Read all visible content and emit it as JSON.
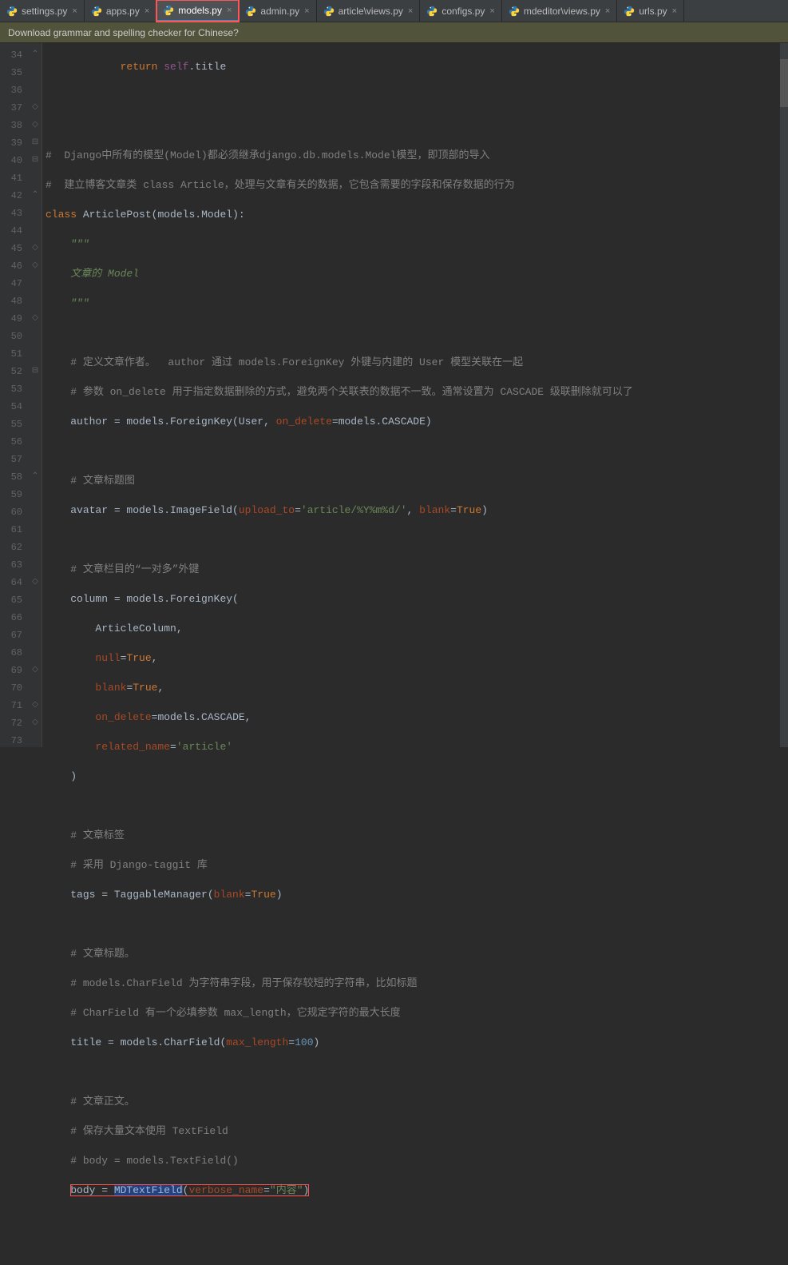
{
  "tabs": [
    {
      "label": "settings.py"
    },
    {
      "label": "apps.py"
    },
    {
      "label": "models.py",
      "active": true,
      "highlighted": true
    },
    {
      "label": "admin.py"
    },
    {
      "label": "article\\views.py"
    },
    {
      "label": "configs.py"
    },
    {
      "label": "mdeditor\\views.py"
    },
    {
      "label": "urls.py"
    }
  ],
  "banner": "Download grammar and spelling checker for Chinese?",
  "lineStart": 34,
  "lineEnd": 73,
  "code": {
    "l34": {
      "kw": "return",
      "self": "self",
      "rest": ".title"
    },
    "l37": "#  Django中所有的模型(Model)都必须继承django.db.models.Model模型，即顶部的导入",
    "l38": "#  建立博客文章类 class Article，处理与文章有关的数据，它包含需要的字段和保存数据的行为",
    "l39": {
      "kw": "class",
      "name": "ArticlePost",
      "rest": "(models.Model):"
    },
    "l40": "\"\"\"",
    "l41": {
      "a": "文章的 ",
      "b": "Model"
    },
    "l42": "\"\"\"",
    "l44": "# 定义文章作者。  author 通过 models.ForeignKey 外键与内建的 User 模型关联在一起",
    "l45": "# 参数 on_delete 用于指定数据删除的方式，避免两个关联表的数据不一致。通常设置为 CASCADE 级联删除就可以了",
    "l46": {
      "a": "author = models.ForeignKey(User",
      "comma": ", ",
      "p": "on_delete",
      "b": "=models.CASCADE)"
    },
    "l48": "# 文章标题图",
    "l49": {
      "a": "avatar = models.ImageField(",
      "p1": "upload_to",
      "eq1": "=",
      "s": "'article/%Y%m%d/'",
      "c": ", ",
      "p2": "blank",
      "eq2": "=",
      "kw": "True",
      "b": ")"
    },
    "l51": "# 文章栏目的“一对多”外键",
    "l52": "column = models.ForeignKey(",
    "l53": {
      "a": "ArticleColumn",
      "b": ","
    },
    "l54": {
      "p": "null",
      "eq": "=",
      "kw": "True",
      "b": ","
    },
    "l55": {
      "p": "blank",
      "eq": "=",
      "kw": "True",
      "b": ","
    },
    "l56": {
      "p": "on_delete",
      "eq": "=",
      "a": "models.CASCADE",
      "b": ","
    },
    "l57": {
      "p": "related_name",
      "eq": "=",
      "s": "'article'"
    },
    "l58": ")",
    "l60": "# 文章标签",
    "l61": "# 采用 Django-taggit 库",
    "l62": {
      "a": "tags = TaggableManager(",
      "p": "blank",
      "eq": "=",
      "kw": "True",
      "b": ")"
    },
    "l64": "# 文章标题。",
    "l65": "# models.CharField 为字符串字段，用于保存较短的字符串，比如标题",
    "l66": "# CharField 有一个必填参数 max_length，它规定字符的最大长度",
    "l67": {
      "a": "title = models.CharField(",
      "p": "max_length",
      "eq": "=",
      "n": "100",
      "b": ")"
    },
    "l69": "# 文章正文。",
    "l70": "# 保存大量文本使用 TextField",
    "l71": "# body = models.TextField()",
    "l72": {
      "a": "body = ",
      "fn": "MDTextField",
      "b": "(",
      "p": "verbose_name",
      "eq": "=",
      "s": "\"内容\"",
      "c": ")"
    }
  }
}
